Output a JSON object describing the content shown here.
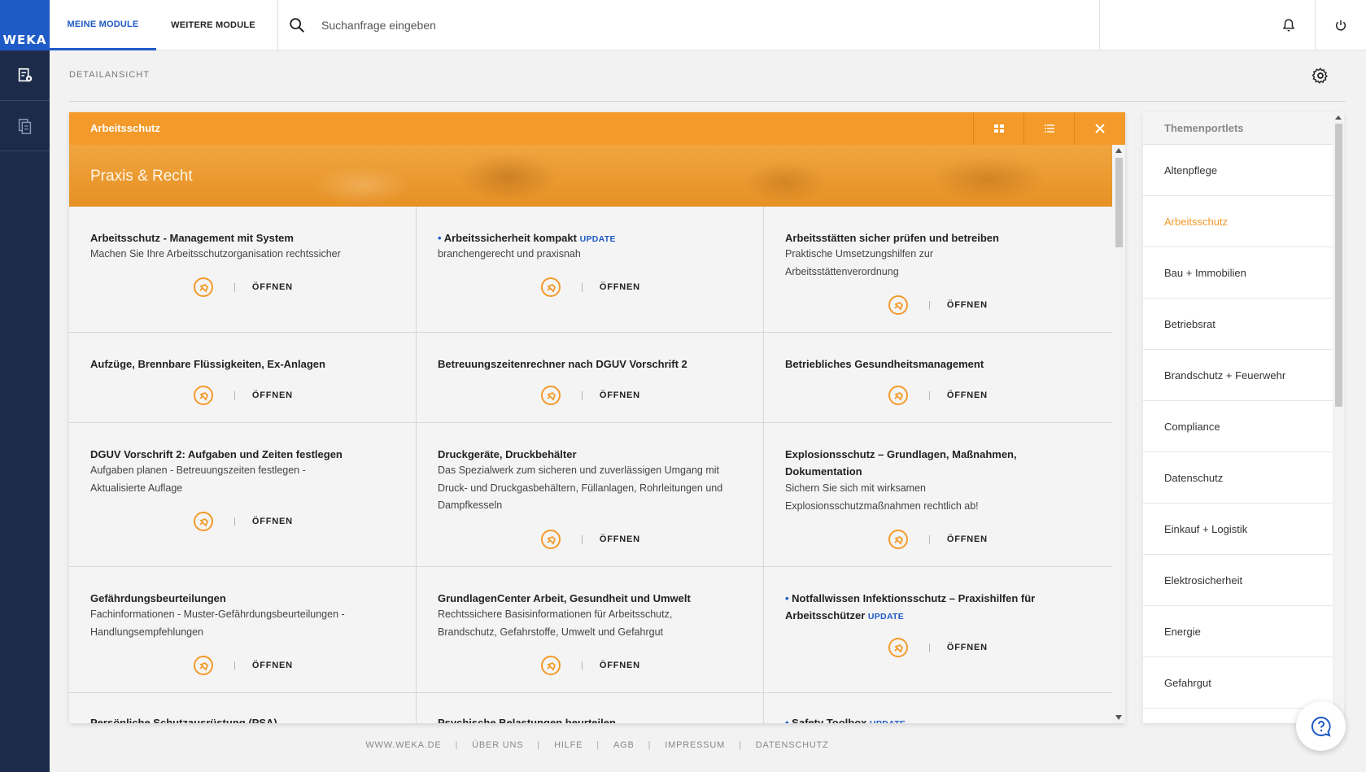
{
  "brand": {
    "logo_text": "WEKA",
    "accent": "#1f5bc7",
    "orange": "#f39a2a",
    "rail": "#1d2b4b"
  },
  "topbar": {
    "tabs": [
      {
        "label": "MEINE MODULE",
        "active": true
      },
      {
        "label": "WEITERE MODULE",
        "active": false
      }
    ],
    "search_placeholder": "Suchanfrage eingeben"
  },
  "page": {
    "label": "DETAILANSICHT"
  },
  "panel": {
    "title": "Arbeitsschutz",
    "banner": "Praxis & Recht",
    "open_label": "ÖFFNEN",
    "update_label": "UPDATE",
    "modules": [
      {
        "title": "Arbeitsschutz - Management mit System",
        "desc": "Machen Sie Ihre Arbeitsschutzorganisation rechtssicher"
      },
      {
        "title": "Arbeitssicherheit kompakt",
        "desc": "branchengerecht und praxisnah"
      },
      {
        "title": "Arbeitsstätten sicher prüfen und betreiben",
        "desc": "Praktische Umsetzungshilfen zur Arbeitsstättenverordnung"
      },
      {
        "title": "Aufzüge, Brennbare Flüssigkeiten, Ex-Anlagen",
        "desc": ""
      },
      {
        "title": "Betreuungszeitenrechner nach DGUV Vorschrift 2",
        "desc": ""
      },
      {
        "title": "Betriebliches Gesundheitsmanagement",
        "desc": ""
      },
      {
        "title": "DGUV Vorschrift 2: Aufgaben und Zeiten festlegen",
        "desc": "Aufgaben planen - Betreuungszeiten festlegen - Aktualisierte Auflage"
      },
      {
        "title": "Druckgeräte, Druckbehälter",
        "desc": "Das Spezialwerk zum sicheren und zuverlässigen Umgang mit Druck- und Druckgasbehältern, Füllanlagen, Rohrleitungen und Dampfkesseln"
      },
      {
        "title": "Explosionsschutz – Grundlagen, Maßnahmen, Dokumentation",
        "desc": "Sichern Sie sich mit wirksamen Explosionsschutzmaßnahmen rechtlich ab!"
      },
      {
        "title": "Gefährdungsbeurteilungen",
        "desc": "Fachinformationen - Muster-Gefährdungsbeurteilungen - Handlungsempfehlungen"
      },
      {
        "title": "GrundlagenCenter Arbeit, Gesundheit und Umwelt",
        "desc": "Rechtssichere Basisinformationen für Arbeitsschutz, Brandschutz, Gefahrstoffe, Umwelt und Gefahrgut"
      },
      {
        "title": "Notfallwissen Infektionsschutz – Praxishilfen für Arbeitsschützer",
        "desc": ""
      },
      {
        "title": "Persönliche Schutzausrüstung (PSA)",
        "desc": ""
      },
      {
        "title": "Psychische Belastungen beurteilen",
        "desc": ""
      },
      {
        "title": "Safety Toolbox",
        "desc": ""
      }
    ]
  },
  "sidebar": {
    "title": "Themenportlets",
    "items": [
      "Altenpflege",
      "Arbeitsschutz",
      "Bau + Immobilien",
      "Betriebsrat",
      "Brandschutz + Feuerwehr",
      "Compliance",
      "Datenschutz",
      "Einkauf + Logistik",
      "Elektrosicherheit",
      "Energie",
      "Gefahrgut"
    ]
  },
  "footer": {
    "links": [
      "WWW.WEKA.DE",
      "ÜBER UNS",
      "HILFE",
      "AGB",
      "IMPRESSUM",
      "DATENSCHUTZ"
    ]
  }
}
